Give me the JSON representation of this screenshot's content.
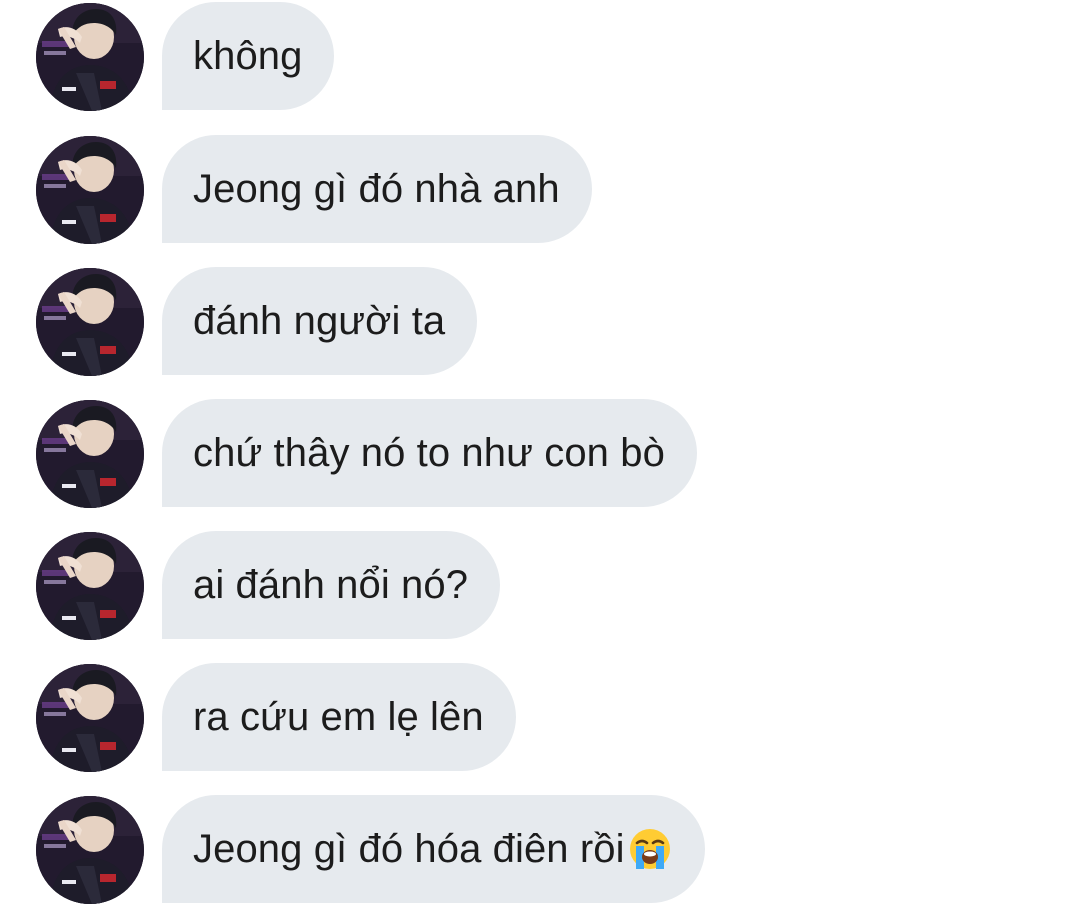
{
  "conversation": {
    "messages": [
      {
        "text": "không",
        "avatar": "profile-avatar-icon"
      },
      {
        "text": "Jeong gì đó nhà anh",
        "avatar": "profile-avatar-icon"
      },
      {
        "text": "đánh người ta",
        "avatar": "profile-avatar-icon"
      },
      {
        "text": "chứ thây nó to như con bò",
        "avatar": "profile-avatar-icon"
      },
      {
        "text": "ai đánh nổi nó?",
        "avatar": "profile-avatar-icon"
      },
      {
        "text": "ra cứu em lẹ lên",
        "avatar": "profile-avatar-icon"
      },
      {
        "text": "Jeong gì đó hóa điên rồi",
        "avatar": "profile-avatar-icon",
        "emoji": "loudly-crying-face-icon"
      }
    ]
  },
  "colors": {
    "bubble_background": "#e6eaee",
    "text": "#1c1c1c",
    "page_background": "#ffffff"
  }
}
